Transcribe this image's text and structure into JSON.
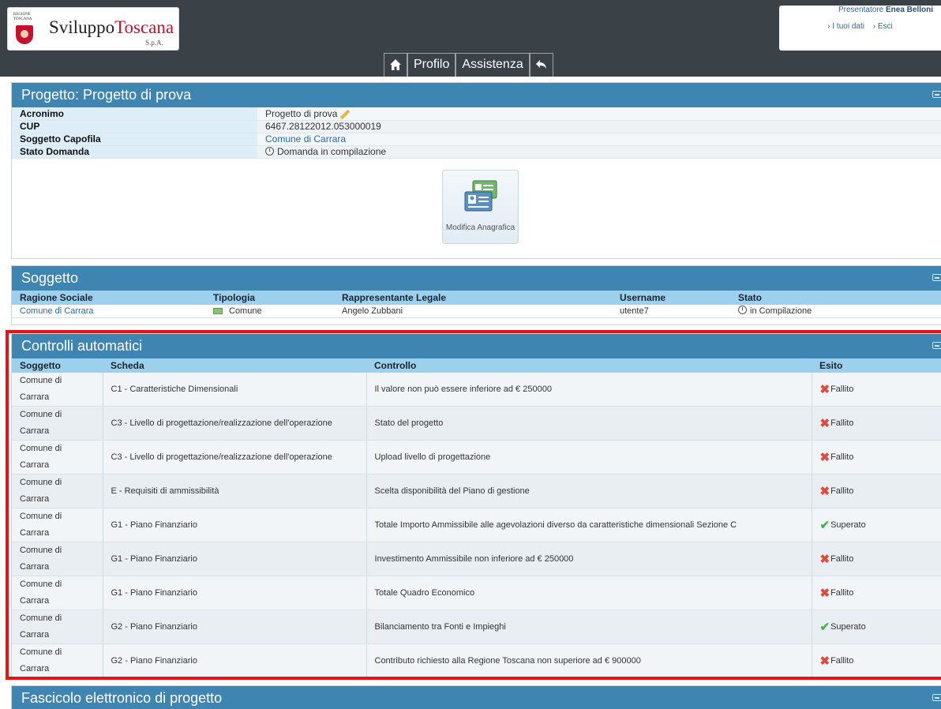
{
  "logo": {
    "region_small": "REGIONE TOSCANA",
    "name_part1": "Sviluppo",
    "name_part2": "Toscana",
    "spa": "S.p.A."
  },
  "user": {
    "presenter_prefix": "Presentatore ",
    "presenter_name": "Enea Belloni",
    "link_data": "› I tuoi dati",
    "link_exit": "› Esci"
  },
  "nav": {
    "home_icon": "home-icon",
    "profilo": "Profilo",
    "assistenza": "Assistenza",
    "back_icon": "back-icon"
  },
  "progetto": {
    "title": "Progetto: Progetto di prova",
    "rows": [
      {
        "label": "Acronimo",
        "value": "Progetto di prova"
      },
      {
        "label": "CUP",
        "value": "6467.28122012.053000019"
      },
      {
        "label": "Soggetto Capofila",
        "value": "Comune di Carrara"
      },
      {
        "label": "Stato Domanda",
        "value": "Domanda in compilazione"
      }
    ],
    "button_label": "Modifica Anagrafica"
  },
  "soggetto": {
    "title": "Soggetto",
    "headers": [
      "Ragione Sociale",
      "Tipologia",
      "Rappresentante Legale",
      "Username",
      "Stato"
    ],
    "row": {
      "ragione": "Comune di Carrara",
      "tipologia": "Comune",
      "rappresentante": "Angelo Zubbani",
      "username": "utente7",
      "stato": "in Compilazione"
    }
  },
  "controlli": {
    "title": "Controlli automatici",
    "headers": [
      "Soggetto",
      "Scheda",
      "Controllo",
      "Esito"
    ],
    "rows": [
      {
        "s1": "Comune di",
        "s2": "Carrara",
        "scheda": "C1 - Caratteristiche Dimensionali",
        "controllo": "Il valore non può essere inferiore ad € 250000",
        "esito": "Fallito"
      },
      {
        "s1": "Comune di",
        "s2": "Carrara",
        "scheda": "C3 - Livello di progettazione/realizzazione dell'operazione",
        "controllo": "Stato del progetto",
        "esito": "Fallito"
      },
      {
        "s1": "Comune di",
        "s2": "Carrara",
        "scheda": "C3 - Livello di progettazione/realizzazione dell'operazione",
        "controllo": "Upload livello di progettazione",
        "esito": "Fallito"
      },
      {
        "s1": "Comune di",
        "s2": "Carrara",
        "scheda": "E - Requisiti di ammissibilità",
        "controllo": "Scelta disponibilità del Piano di gestione",
        "esito": "Fallito"
      },
      {
        "s1": "Comune di",
        "s2": "Carrara",
        "scheda": "G1 - Piano Finanziario",
        "controllo": "Totale Importo Ammissibile alle agevolazioni diverso da caratteristiche dimensionali Sezione C",
        "esito": "Superato"
      },
      {
        "s1": "Comune di",
        "s2": "Carrara",
        "scheda": "G1 - Piano Finanziario",
        "controllo": "Investimento Ammissibile non inferiore ad € 250000",
        "esito": "Fallito"
      },
      {
        "s1": "Comune di",
        "s2": "Carrara",
        "scheda": "G1 - Piano Finanziario",
        "controllo": "Totale Quadro Economico",
        "esito": "Fallito"
      },
      {
        "s1": "Comune di",
        "s2": "Carrara",
        "scheda": "G2 - Piano Finanziario",
        "controllo": "Bilanciamento tra Fonti e Impieghi",
        "esito": "Superato"
      },
      {
        "s1": "Comune di",
        "s2": "Carrara",
        "scheda": "G2 - Piano Finanziario",
        "controllo": "Contributo richiesto alla Regione Toscana non superiore ad € 900000",
        "esito": "Fallito"
      }
    ]
  },
  "fascicolo": {
    "title": "Fascicolo elettronico di progetto"
  },
  "colors": {
    "header_bg": "#3a4248",
    "panel_head": "#3f85b2",
    "table_head": "#9cd0ec",
    "highlight": "#ee1111",
    "fail": "#e04a3a",
    "pass": "#4caf50"
  }
}
